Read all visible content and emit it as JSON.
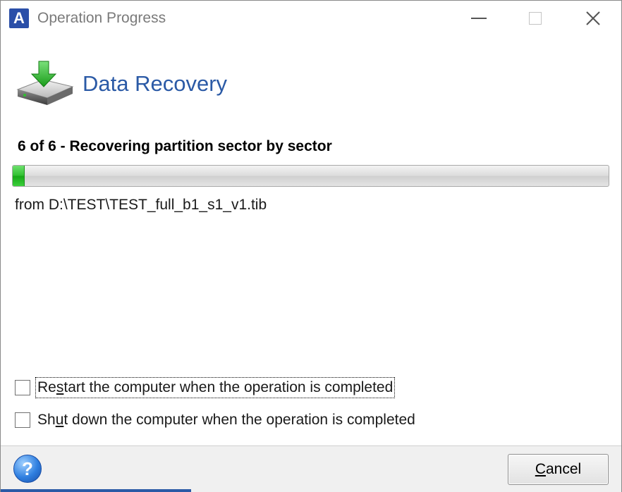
{
  "window": {
    "app_icon_letter": "A",
    "title": "Operation Progress"
  },
  "header": {
    "title": "Data Recovery",
    "icon": "disk-download-icon"
  },
  "operation": {
    "step_label": "6 of 6 - Recovering partition sector by sector",
    "progress_percent": 2,
    "source_label": "from D:\\TEST\\TEST_full_b1_s1_v1.tib"
  },
  "options": {
    "restart": {
      "label_pre": "Re",
      "label_key": "s",
      "label_post": "tart the computer when the operation is completed",
      "checked": false
    },
    "shutdown": {
      "label_pre": "Sh",
      "label_key": "u",
      "label_post": "t down the computer when the operation is completed",
      "checked": false
    }
  },
  "footer": {
    "help_icon": "help-icon",
    "help_glyph": "?",
    "cancel_key": "C",
    "cancel_rest": "ancel"
  },
  "colors": {
    "accent": "#2b5aa6",
    "progress": "#2fbf2f"
  }
}
